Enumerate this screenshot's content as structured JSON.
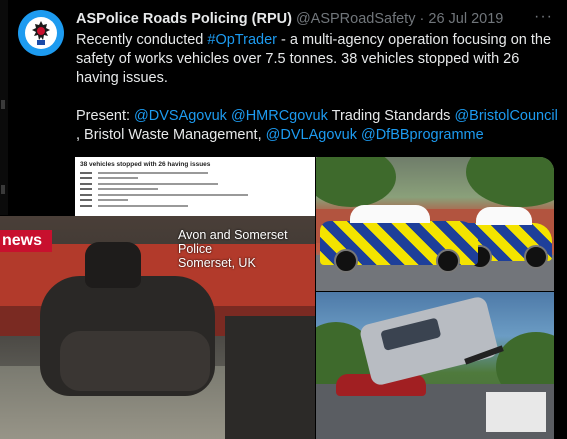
{
  "tweet": {
    "author_name": "ASPolice Roads Policing (RPU)",
    "handle": "@ASPRoadSafety",
    "separator": "·",
    "date": "26 Jul 2019",
    "more_label": "···",
    "text_1": "Recently conducted ",
    "hashtag": "#OpTrader",
    "text_2": " - a multi-agency operation focusing on the safety of works vehicles over 7.5 tonnes.  38 vehicles stopped with 26 having issues.",
    "present_prefix": "Present: ",
    "mention_1": "@DVSAgovuk",
    "space_1": " ",
    "mention_2": "@HMRCgovuk",
    "trading_standards": " Trading Standards ",
    "mention_3": "@BristolCouncil",
    "bristol_waste": " , Bristol Waste Management, ",
    "mention_4": "@DVLAgovuk",
    "space_2": "  ",
    "mention_5": "@DfBBprogramme"
  },
  "media": {
    "doc_title": "38 vehicles stopped with 26 having issues",
    "news_badge": "news",
    "caption_line1": "Avon and Somerset Police",
    "caption_line2": "Somerset, UK"
  },
  "icons": {
    "avatar": "police-crest-icon",
    "more": "more-options-icon"
  },
  "colors": {
    "link": "#1d9bf0",
    "background": "#000000",
    "news_red": "#c8102e"
  }
}
